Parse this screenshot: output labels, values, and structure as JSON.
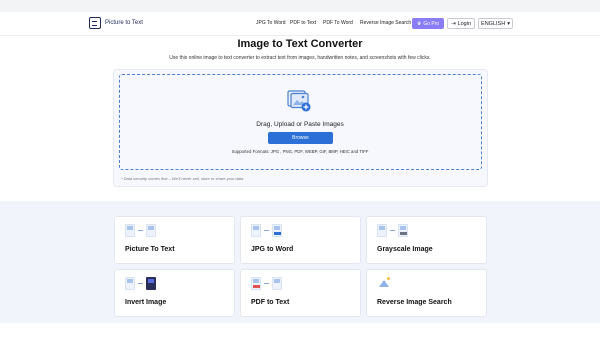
{
  "header": {
    "logo_text": "Picture to Text",
    "nav": [
      "JPG To Word",
      "PDF to Text",
      "PDF To Word",
      "Reverse Image Search"
    ],
    "go_pro": "Go Pro",
    "login": "Login",
    "language": "ENGLISH",
    "colors": {
      "brand": "#1f2a5c",
      "go_pro_bg": "#8a7cf5"
    }
  },
  "main": {
    "title": "Image to Text Converter",
    "subtitle": "Use this online image to text converter to extract text from images, handwritten notes, and screenshots with few clicks.",
    "drag_text": "Drag, Upload or Paste Images",
    "browse_label": "Browse",
    "formats": "Supported Formats: JPG , PNG, PDF, WEBP, GIF, BMP, HEIC and TIFF",
    "security_note": "* Data security comes first – We'll never sell, store or share your data",
    "colors": {
      "accent": "#2c6fd6",
      "dash": "#4d7fd1"
    }
  },
  "tools": [
    {
      "label": "Picture To Text"
    },
    {
      "label": "JPG to Word"
    },
    {
      "label": "Grayscale Image"
    },
    {
      "label": "Invert Image"
    },
    {
      "label": "PDF to Text"
    },
    {
      "label": "Reverse Image Search"
    }
  ]
}
